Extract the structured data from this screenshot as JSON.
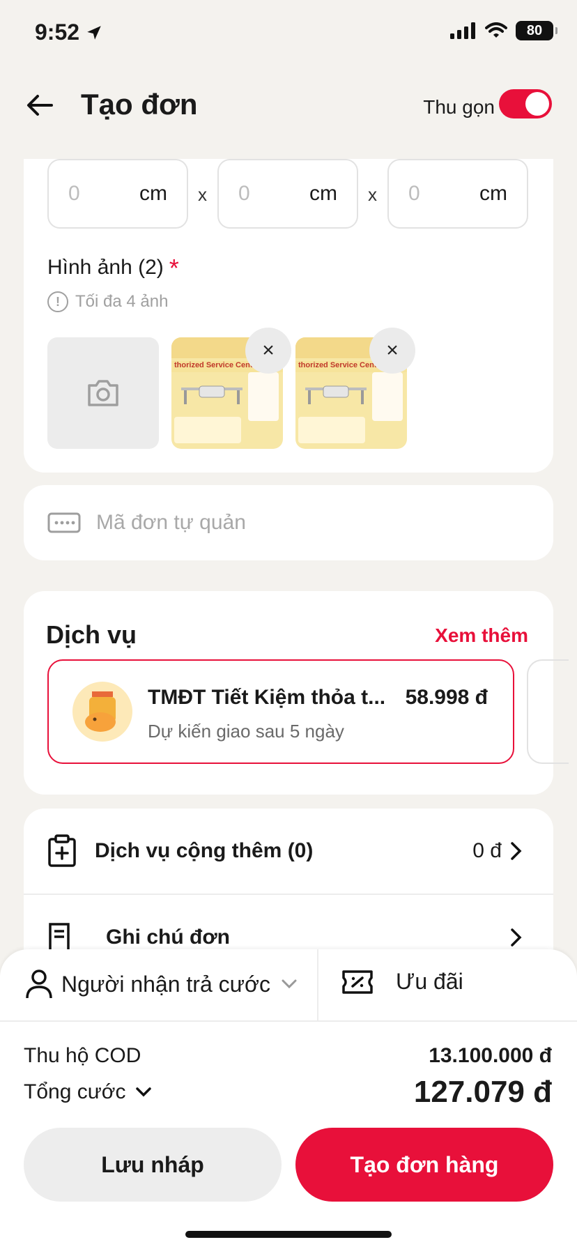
{
  "status_bar": {
    "time": "9:52",
    "battery": "80"
  },
  "header": {
    "title": "Tạo đơn",
    "collapse_label": "Thu gọn",
    "collapse_on": true
  },
  "dimensions": {
    "fields": [
      {
        "placeholder": "0",
        "unit": "cm"
      },
      {
        "placeholder": "0",
        "unit": "cm"
      },
      {
        "placeholder": "0",
        "unit": "cm"
      }
    ],
    "separator": "x"
  },
  "images": {
    "label": "Hình ảnh (2)",
    "required_mark": "*",
    "hint": "Tối đa 4 ảnh",
    "thumbnails": [
      {
        "caption": "thorized Service Center",
        "remove": "×"
      },
      {
        "caption": "thorized Service Center",
        "remove": "×"
      }
    ]
  },
  "order_code": {
    "placeholder": "Mã đơn tự quản"
  },
  "service": {
    "title": "Dịch vụ",
    "more": "Xem thêm",
    "selected": {
      "name": "TMĐT Tiết Kiệm thỏa t...",
      "price": "58.998 đ",
      "eta": "Dự kiến giao sau 5 ngày"
    }
  },
  "addons": {
    "extra_service": {
      "label": "Dịch vụ cộng thêm (0)",
      "value": "0 đ"
    },
    "note": {
      "label": "Ghi chú đơn"
    }
  },
  "summary": {
    "payer": "Người nhận trả cước",
    "promo": "Ưu đãi",
    "cod_label": "Thu hộ COD",
    "cod_value": "13.100.000 đ",
    "total_label": "Tổng cước",
    "total_value": "127.079 đ"
  },
  "actions": {
    "draft": "Lưu nháp",
    "create": "Tạo đơn hàng"
  },
  "colors": {
    "accent": "#e8103a",
    "background": "#f4f2ee"
  }
}
